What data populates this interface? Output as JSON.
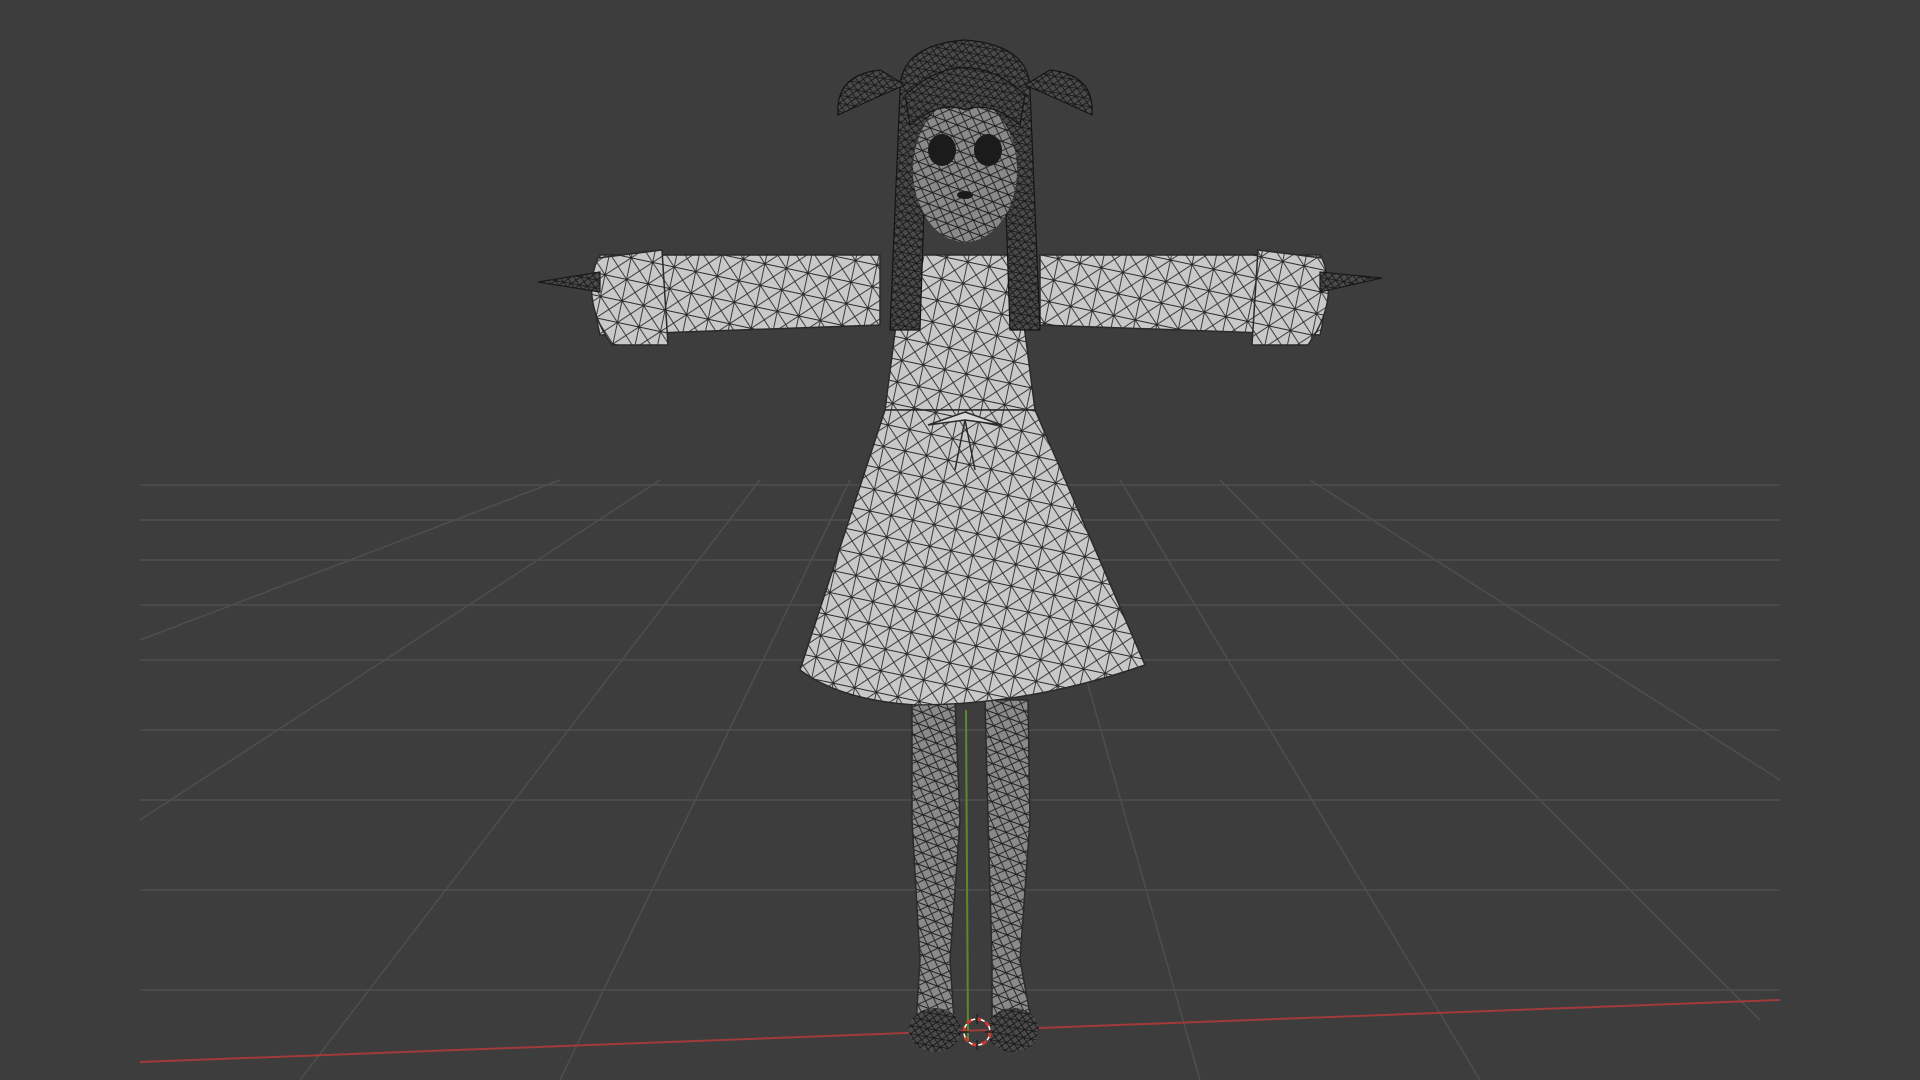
{
  "viewport": {
    "background_color": "#3d3d3d",
    "grid_line_color": "#4e4e4e",
    "x_axis_color": "#a13a3a",
    "y_axis_color": "#5b8a2e"
  },
  "model": {
    "shading": "wireframe",
    "pose": "T-pose",
    "surface_color": "#c9c9c9",
    "wire_color": "#2a2a2a"
  },
  "cursor_3d": {
    "icon": "3d-cursor-icon",
    "ring_color": "#d03a2e"
  }
}
